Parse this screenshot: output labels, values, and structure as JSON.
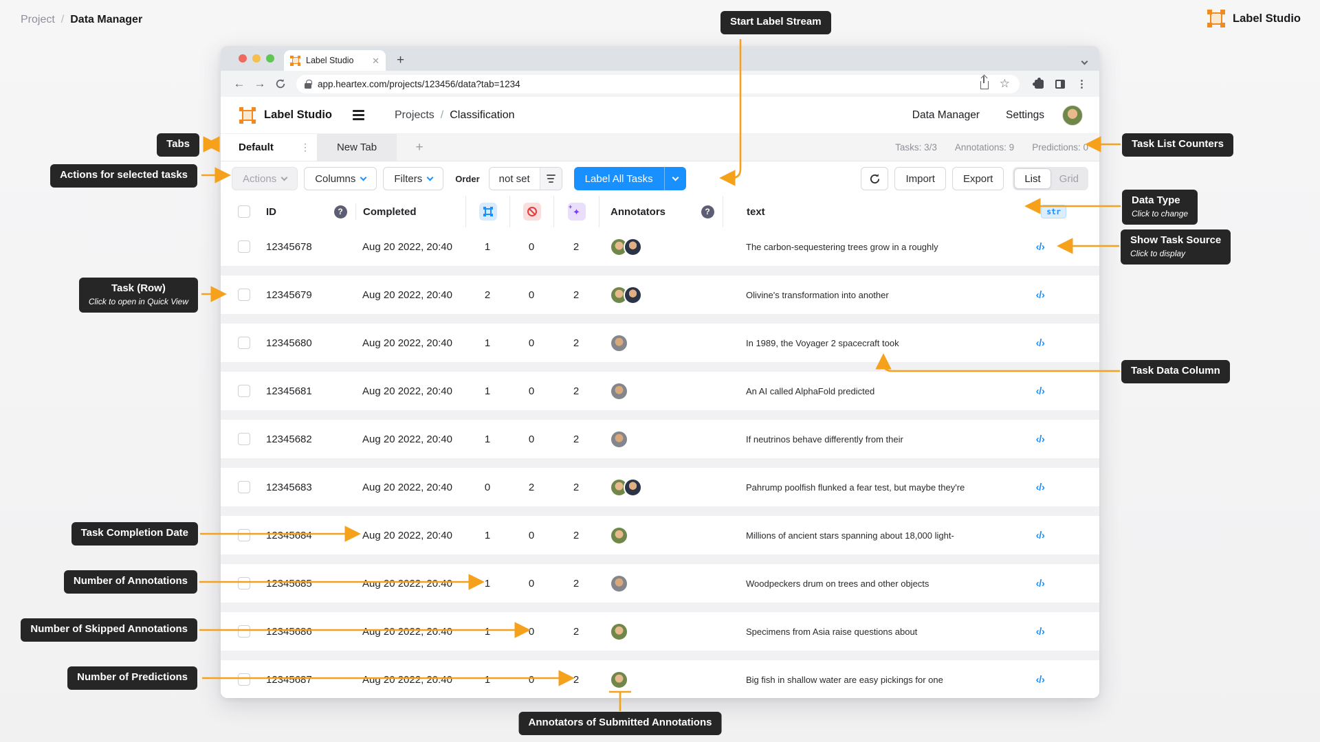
{
  "page": {
    "breadcrumb": {
      "parent": "Project",
      "separator": "/",
      "current": "Data Manager"
    },
    "brand": "Label Studio"
  },
  "browser": {
    "tab_title": "Label Studio",
    "close_tab": "✕",
    "new_tab": "+",
    "url": "app.heartex.com/projects/123456/data?tab=1234",
    "menu_dots": "⋮",
    "star": "☆",
    "back": "←",
    "forward": "→"
  },
  "app_header": {
    "logo_text": "Label Studio",
    "breadcrumb_parent": "Projects",
    "breadcrumb_separator": "/",
    "breadcrumb_current": "Classification",
    "nav_data_manager": "Data Manager",
    "nav_settings": "Settings"
  },
  "tabs_bar": {
    "active_tab": "Default",
    "tab_menu": "⋮",
    "new_tab": "New Tab",
    "add_tab": "+",
    "counters": {
      "tasks": "Tasks: 3/3",
      "annotations": "Annotations: 9",
      "predictions": "Predictions: 0"
    }
  },
  "toolbar": {
    "actions": "Actions",
    "columns": "Columns",
    "filters": "Filters",
    "order_label": "Order",
    "order_value": "not set",
    "label_all_tasks": "Label All Tasks",
    "import": "Import",
    "export": "Export",
    "view_list": "List",
    "view_grid": "Grid"
  },
  "table": {
    "headers": {
      "id": "ID",
      "completed": "Completed",
      "annotators": "Annotators",
      "text": "text"
    },
    "help_glyph": "?",
    "data_type_badge": "str",
    "source_icon": "‹/›",
    "icons": {
      "annotations_column": "bounding-box-icon",
      "skipped_column": "prohibited-icon",
      "predictions_column": "sparkles-icon",
      "source": "code-icon"
    },
    "rows": [
      {
        "id": "12345678",
        "completed": "Aug 20 2022, 20:40",
        "annotations": "1",
        "skipped": "0",
        "predictions": "2",
        "avatars": [
          "w",
          "m"
        ],
        "text": "The carbon-sequestering trees grow in a roughly"
      },
      {
        "id": "12345679",
        "completed": "Aug 20 2022, 20:40",
        "annotations": "2",
        "skipped": "0",
        "predictions": "2",
        "avatars": [
          "w",
          "m"
        ],
        "text": "Olivine's transformation into another"
      },
      {
        "id": "12345680",
        "completed": "Aug 20 2022, 20:40",
        "annotations": "1",
        "skipped": "0",
        "predictions": "2",
        "avatars": [
          "m2"
        ],
        "text": "In 1989, the Voyager 2 spacecraft took"
      },
      {
        "id": "12345681",
        "completed": "Aug 20 2022, 20:40",
        "annotations": "1",
        "skipped": "0",
        "predictions": "2",
        "avatars": [
          "m2"
        ],
        "text": "An AI called AlphaFold predicted"
      },
      {
        "id": "12345682",
        "completed": "Aug 20 2022, 20:40",
        "annotations": "1",
        "skipped": "0",
        "predictions": "2",
        "avatars": [
          "m2"
        ],
        "text": "If neutrinos behave differently from their"
      },
      {
        "id": "12345683",
        "completed": "Aug 20 2022, 20:40",
        "annotations": "0",
        "skipped": "2",
        "predictions": "2",
        "avatars": [
          "w",
          "m"
        ],
        "text": "Pahrump poolfish flunked a fear test, but maybe they're"
      },
      {
        "id": "12345684",
        "completed": "Aug 20 2022, 20:40",
        "annotations": "1",
        "skipped": "0",
        "predictions": "2",
        "avatars": [
          "w"
        ],
        "text": "Millions of ancient stars spanning about 18,000 light-"
      },
      {
        "id": "12345685",
        "completed": "Aug 20 2022, 20:40",
        "annotations": "1",
        "skipped": "0",
        "predictions": "2",
        "avatars": [
          "m2"
        ],
        "text": "Woodpeckers drum on trees and other objects"
      },
      {
        "id": "12345686",
        "completed": "Aug 20 2022, 20:40",
        "annotations": "1",
        "skipped": "0",
        "predictions": "2",
        "avatars": [
          "w"
        ],
        "text": "Specimens from Asia raise questions about"
      },
      {
        "id": "12345687",
        "completed": "Aug 20 2022, 20:40",
        "annotations": "1",
        "skipped": "0",
        "predictions": "2",
        "avatars": [
          "w"
        ],
        "text": "Big fish in shallow water are easy pickings for one"
      }
    ]
  },
  "callouts": {
    "start_label_stream": "Start Label Stream",
    "tabs": "Tabs",
    "actions_for_selected": "Actions for selected tasks",
    "task_list_counters": "Task List Counters",
    "data_type": {
      "title": "Data Type",
      "subtitle": "Click to change"
    },
    "show_task_source": {
      "title": "Show Task Source",
      "subtitle": "Click to display"
    },
    "task_row": {
      "title": "Task (Row)",
      "subtitle": "Click to open in Quick View"
    },
    "task_data_column": "Task Data Column",
    "task_completion_date": "Task Completion Date",
    "number_of_annotations": "Number of Annotations",
    "number_of_skipped_annotations": "Number of Skipped Annotations",
    "number_of_predictions": "Number of Predictions",
    "annotators_of_submitted": "Annotators of Submitted Annotations"
  },
  "colors": {
    "accent_orange": "#F5A11C",
    "primary_blue": "#1990FF",
    "callout_bg": "#262626"
  }
}
